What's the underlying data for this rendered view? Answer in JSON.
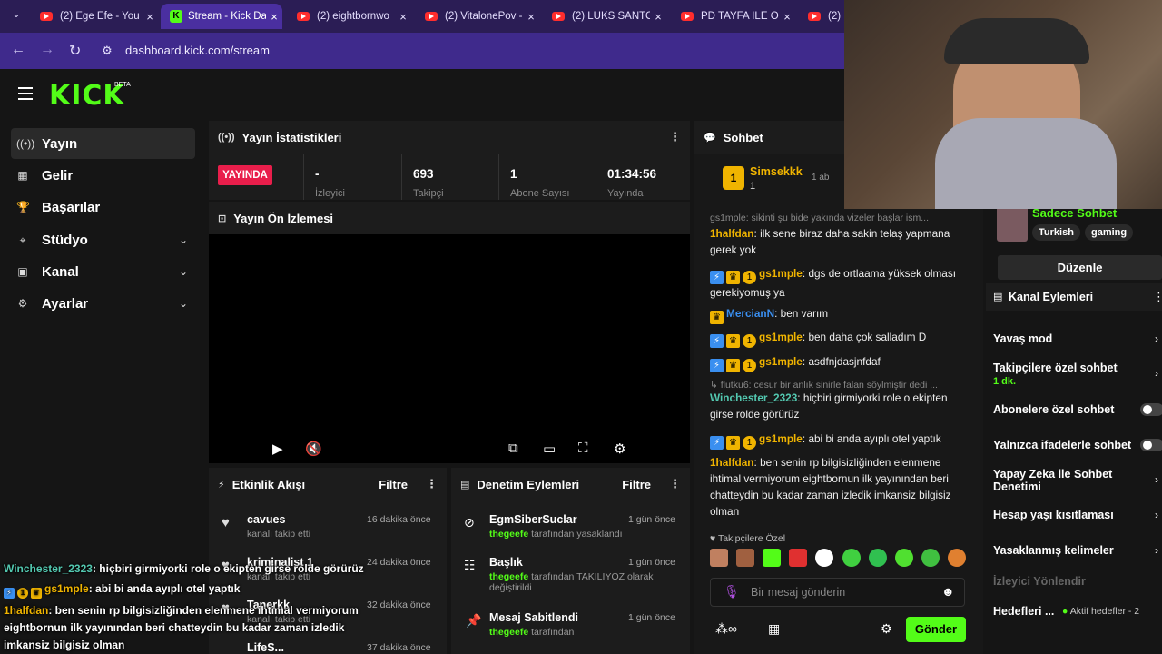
{
  "browser": {
    "tabs": [
      {
        "title": "(2) Ege Efe - You",
        "active": false,
        "kind": "yt"
      },
      {
        "title": "Stream - Kick Da",
        "active": true,
        "kind": "kick"
      },
      {
        "title": "(2) eightbornwo",
        "active": false,
        "kind": "yt"
      },
      {
        "title": "(2) VitalonePov -",
        "active": false,
        "kind": "yt"
      },
      {
        "title": "(2) LÜKS SANTO",
        "active": false,
        "kind": "yt"
      },
      {
        "title": "PD TAYFA İLE OF",
        "active": false,
        "kind": "yt"
      },
      {
        "title": "(2) h",
        "active": false,
        "kind": "yt"
      }
    ],
    "url": "dashboard.kick.com/stream"
  },
  "brand": {
    "logo": "KICK",
    "beta": "BETA",
    "accent": "#53fc18"
  },
  "sidebar": {
    "items": [
      {
        "label": "Yayın",
        "icon": "broadcast-icon",
        "chevron": false
      },
      {
        "label": "Gelir",
        "icon": "revenue-icon",
        "chevron": false
      },
      {
        "label": "Başarılar",
        "icon": "trophy-icon",
        "chevron": false
      },
      {
        "label": "Stüdyo",
        "icon": "studio-icon",
        "chevron": true
      },
      {
        "label": "Kanal",
        "icon": "channel-icon",
        "chevron": true
      },
      {
        "label": "Ayarlar",
        "icon": "gear-icon",
        "chevron": true
      }
    ]
  },
  "stats": {
    "title": "Yayın İstatistikleri",
    "live_label": "YAYINDA",
    "items": [
      {
        "value": "-",
        "label": "İzleyici"
      },
      {
        "value": "693",
        "label": "Takipçi"
      },
      {
        "value": "1",
        "label": "Abone Sayısı"
      },
      {
        "value": "01:34:56",
        "label": "Yayında"
      }
    ]
  },
  "preview": {
    "title": "Yayın Ön İzlemesi"
  },
  "activity": {
    "title": "Etkinlik Akışı",
    "filter": "Filtre",
    "items": [
      {
        "name": "cavues",
        "sub": "kanalı takip etti",
        "time": "16 dakika önce"
      },
      {
        "name": "kriminalist 1",
        "sub": "kanalı takip etti",
        "time": "24 dakika önce"
      },
      {
        "name": "Tanerkk",
        "sub": "kanalı takip etti",
        "time": "32 dakika önce"
      },
      {
        "name": "LifeS...",
        "sub": "",
        "time": "37 dakika önce"
      }
    ]
  },
  "moderation": {
    "title": "Denetim Eylemleri",
    "filter": "Filtre",
    "items": [
      {
        "title": "EgmSiberSuclar",
        "actor": "thegeefe",
        "action": "tarafından yasaklandı",
        "time": "1 gün önce"
      },
      {
        "title": "Başlık",
        "actor": "thegeefe",
        "action": "tarafından TAKILIYOZ olarak değiştirildi",
        "time": "1 gün önce"
      },
      {
        "title": "Mesaj Sabitlendi",
        "actor": "thegeefe",
        "action": "tarafından",
        "time": "1 gün önce"
      }
    ]
  },
  "chat": {
    "title": "Sohbet",
    "top_gifter": {
      "rank": "1",
      "name": "Simsekkk",
      "count": "1",
      "next": "1 ab"
    },
    "pinned_snippet": "gs1mple: sikinti şu bide yakında vizeler başlar ism...",
    "messages": [
      {
        "user": "1halfdan",
        "color": "#f0b400",
        "badges": [],
        "text": "ilk sene biraz daha sakin telaş yapmana gerek yok"
      },
      {
        "user": "gs1mple",
        "color": "#f0b400",
        "badges": [
          "blue",
          "crown",
          "gold"
        ],
        "text": "dgs de ortlaama yüksek olması gerekiyomuş ya"
      },
      {
        "user": "MercianN",
        "color": "#3a8ff0",
        "badges": [
          "crown"
        ],
        "text": "ben varım"
      },
      {
        "user": "gs1mple",
        "color": "#f0b400",
        "badges": [
          "blue",
          "crown",
          "gold"
        ],
        "text": "ben daha çok salladım D"
      },
      {
        "user": "gs1mple",
        "color": "#f0b400",
        "badges": [
          "blue",
          "crown",
          "gold"
        ],
        "text": "asdfnjdasjnfdaf"
      },
      {
        "reply": "flutku6: cesur bir anlık sinirle falan söylmiştir dedi ...",
        "user": "Winchester_2323",
        "color": "#53c8b0",
        "badges": [],
        "text": "hiçbiri girmiyorki role o ekipten girse rolde görürüz"
      },
      {
        "user": "gs1mple",
        "color": "#f0b400",
        "badges": [
          "blue",
          "crown",
          "gold"
        ],
        "text": "abi bi anda ayıplı otel yaptık"
      },
      {
        "user": "1halfdan",
        "color": "#f0b400",
        "badges": [],
        "text": "ben senin rp bilgisizliğinden elenmene ihtimal vermiyorum eightbornun ilk yayınından beri chatteydin bu kadar zaman izledik imkansiz bilgisiz olman"
      }
    ],
    "followers_only": "Takipçilere Özel",
    "placeholder": "Bir mesaj gönderin",
    "send": "Gönder"
  },
  "channel": {
    "category": "Sadece Sohbet",
    "tags": [
      "Turkish",
      "gaming"
    ],
    "edit": "Düzenle",
    "actions_title": "Kanal Eylemleri",
    "actions": [
      {
        "label": "Yavaş mod",
        "control": "chevron"
      },
      {
        "label": "Takipçilere özel sohbet",
        "sub": "1 dk.",
        "control": "chevron"
      },
      {
        "label": "Abonelere özel sohbet",
        "control": "toggle"
      },
      {
        "label": "Yalnızca ifadelerle sohbet",
        "control": "toggle"
      },
      {
        "label": "Yapay Zeka ile Sohbet Denetimi",
        "control": "chevron"
      },
      {
        "label": "Hesap yaşı kısıtlaması",
        "control": "chevron"
      },
      {
        "label": "Yasaklanmış kelimeler",
        "control": "chevron"
      },
      {
        "label": "İzleyici Yönlendir",
        "control": "none"
      },
      {
        "label": "Hedefleri ...",
        "sub": "Aktif hedefler - 2",
        "control": "none"
      }
    ]
  },
  "overlay": {
    "messages": [
      {
        "user": "Winchester_2323",
        "text": ": hiçbiri girmiyorki role o ekipten girse rolde görürüz"
      },
      {
        "user": "gs1mple",
        "text": ": abi bi anda ayıplı otel yaptık"
      },
      {
        "user": "1halfdan",
        "text": ": ben senin rp bilgisizliğinden elenmene ihtimal vermiyorum eightbornun ilk yayınından beri chatteydin bu kadar zaman izledik imkansiz bilgisiz olman"
      }
    ]
  }
}
